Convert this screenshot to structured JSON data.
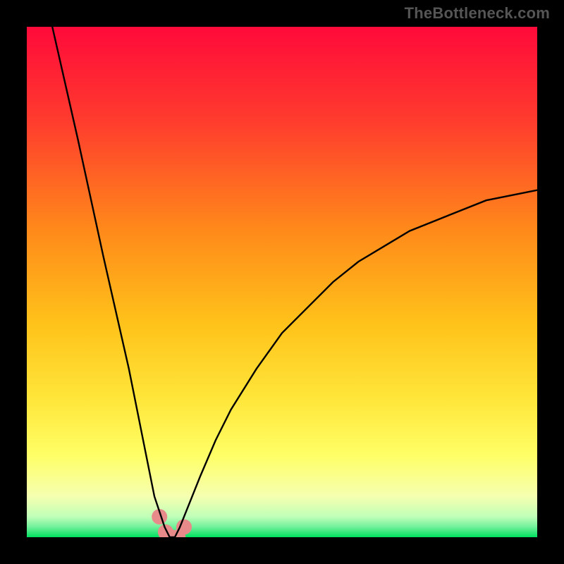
{
  "watermark": "TheBottleneck.com",
  "chart_data": {
    "type": "line",
    "title": "",
    "xlabel": "",
    "ylabel": "",
    "xlim": [
      0,
      100
    ],
    "ylim": [
      0,
      100
    ],
    "gradient_colors_top_to_bottom": [
      "#ff0040",
      "#ff8a00",
      "#ffe600",
      "#ffff66",
      "#00e060"
    ],
    "curve_description": "black V-shaped curve with minimum near x≈28, right arm asymptoting around y≈68",
    "series": [
      {
        "name": "curve",
        "x": [
          5,
          10,
          15,
          20,
          23,
          25,
          27,
          28,
          29,
          30,
          32,
          34,
          37,
          40,
          45,
          50,
          55,
          60,
          65,
          70,
          75,
          80,
          85,
          90,
          95,
          100
        ],
        "y": [
          100,
          78,
          55,
          33,
          18,
          8,
          2,
          0,
          0,
          2,
          7,
          12,
          19,
          25,
          33,
          40,
          45,
          50,
          54,
          57,
          60,
          62,
          64,
          66,
          67,
          68
        ]
      }
    ],
    "markers": {
      "name": "pink-blob",
      "color": "#e88a8a",
      "points_x": [
        26.0,
        27.2,
        28.4,
        29.6,
        30.8
      ],
      "points_y": [
        4.0,
        1.0,
        0.0,
        0.0,
        2.0
      ],
      "radius_px": 11
    }
  }
}
